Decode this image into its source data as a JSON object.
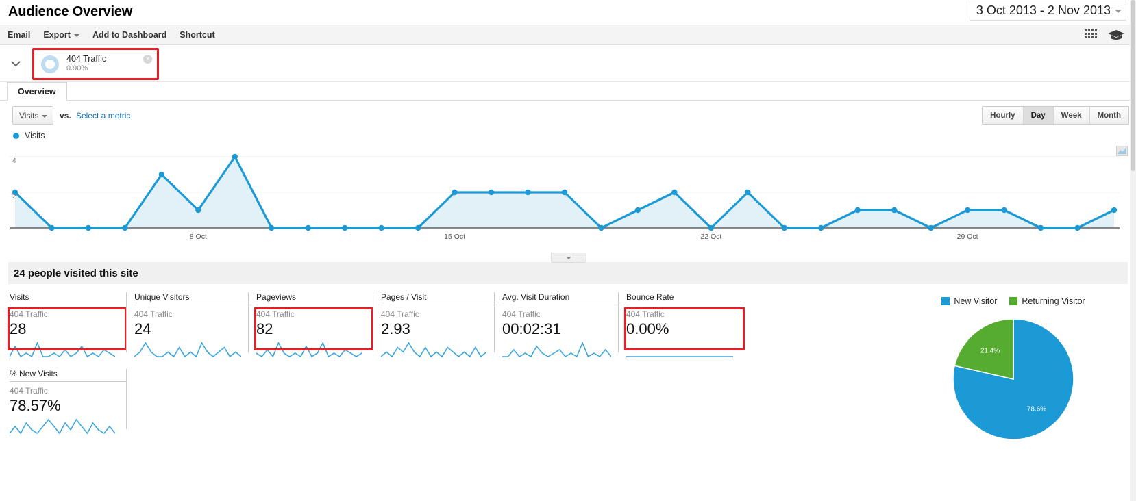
{
  "header": {
    "title": "Audience Overview",
    "date_range": "3 Oct 2013 - 2 Nov 2013"
  },
  "toolbar": {
    "items": [
      {
        "label": "Email",
        "caret": false
      },
      {
        "label": "Export",
        "caret": true
      },
      {
        "label": "Add to Dashboard",
        "caret": false
      },
      {
        "label": "Shortcut",
        "caret": false
      }
    ],
    "right_icons": [
      "grid-icon",
      "graduation-cap-icon"
    ]
  },
  "segment": {
    "name": "404 Traffic",
    "percent": "0.90%",
    "close_glyph": "×",
    "highlight_color": "#ec1c24",
    "donut_color": "#bedcf0"
  },
  "tabs": [
    {
      "label": "Overview",
      "active": true
    }
  ],
  "metric_selector": {
    "selected": "Visits",
    "vs_label": "vs.",
    "compare_link": "Select a metric"
  },
  "period_buttons": [
    {
      "label": "Hourly",
      "active": false
    },
    {
      "label": "Day",
      "active": true
    },
    {
      "label": "Week",
      "active": false
    },
    {
      "label": "Month",
      "active": false
    }
  ],
  "people_banner": "24 people visited this site",
  "chart_data": {
    "type": "line",
    "title": "Visits",
    "legend": [
      "Visits"
    ],
    "legend_position": "top-left",
    "xlabel": "",
    "ylabel": "",
    "ylim": [
      0,
      4
    ],
    "yticks": [
      0,
      2,
      4
    ],
    "ytick_labels": [
      "",
      "2",
      "4"
    ],
    "grid": true,
    "line_color": "#1c9ad6",
    "fill_color": "#e2f0f8",
    "x_tick_labels": [
      "8 Oct",
      "15 Oct",
      "22 Oct",
      "29 Oct"
    ],
    "x_tick_indices": [
      5,
      12,
      19,
      26
    ],
    "categories": [
      "3 Oct",
      "4 Oct",
      "5 Oct",
      "6 Oct",
      "7 Oct",
      "8 Oct",
      "9 Oct",
      "10 Oct",
      "11 Oct",
      "12 Oct",
      "13 Oct",
      "14 Oct",
      "15 Oct",
      "16 Oct",
      "17 Oct",
      "18 Oct",
      "19 Oct",
      "20 Oct",
      "21 Oct",
      "22 Oct",
      "23 Oct",
      "24 Oct",
      "25 Oct",
      "26 Oct",
      "27 Oct",
      "28 Oct",
      "29 Oct",
      "30 Oct",
      "31 Oct",
      "1 Nov",
      "2 Nov"
    ],
    "values": [
      2,
      0,
      0,
      0,
      3,
      1,
      4,
      0,
      0,
      0,
      0,
      0,
      2,
      2,
      2,
      2,
      0,
      1,
      2,
      0,
      2,
      0,
      0,
      1,
      1,
      0,
      1,
      1,
      0,
      0,
      1
    ],
    "series": [
      {
        "name": "Visits",
        "values": [
          2,
          0,
          0,
          0,
          3,
          1,
          4,
          0,
          0,
          0,
          0,
          0,
          2,
          2,
          2,
          2,
          0,
          1,
          2,
          0,
          2,
          0,
          0,
          1,
          1,
          0,
          1,
          1,
          0,
          0,
          1
        ]
      }
    ]
  },
  "metrics": [
    {
      "title": "Visits",
      "segment": "404 Traffic",
      "value": "28",
      "highlighted": true
    },
    {
      "title": "Unique Visitors",
      "segment": "404 Traffic",
      "value": "24",
      "highlighted": false
    },
    {
      "title": "Pageviews",
      "segment": "404 Traffic",
      "value": "82",
      "highlighted": true
    },
    {
      "title": "Pages / Visit",
      "segment": "404 Traffic",
      "value": "2.93",
      "highlighted": false
    },
    {
      "title": "Avg. Visit Duration",
      "segment": "404 Traffic",
      "value": "00:02:31",
      "highlighted": false
    },
    {
      "title": "Bounce Rate",
      "segment": "404 Traffic",
      "value": "0.00%",
      "highlighted": true
    },
    {
      "title": "% New Visits",
      "segment": "404 Traffic",
      "value": "78.57%",
      "highlighted": false
    }
  ],
  "pie_chart": {
    "type": "pie",
    "title": "",
    "legend": [
      "New Visitor",
      "Returning Visitor"
    ],
    "legend_position": "top",
    "categories": [
      "New Visitor",
      "Returning Visitor"
    ],
    "values": [
      78.6,
      21.4
    ],
    "labels": [
      "78.6%",
      "21.4%"
    ],
    "colors": [
      "#1c9ad6",
      "#56ac30"
    ]
  }
}
